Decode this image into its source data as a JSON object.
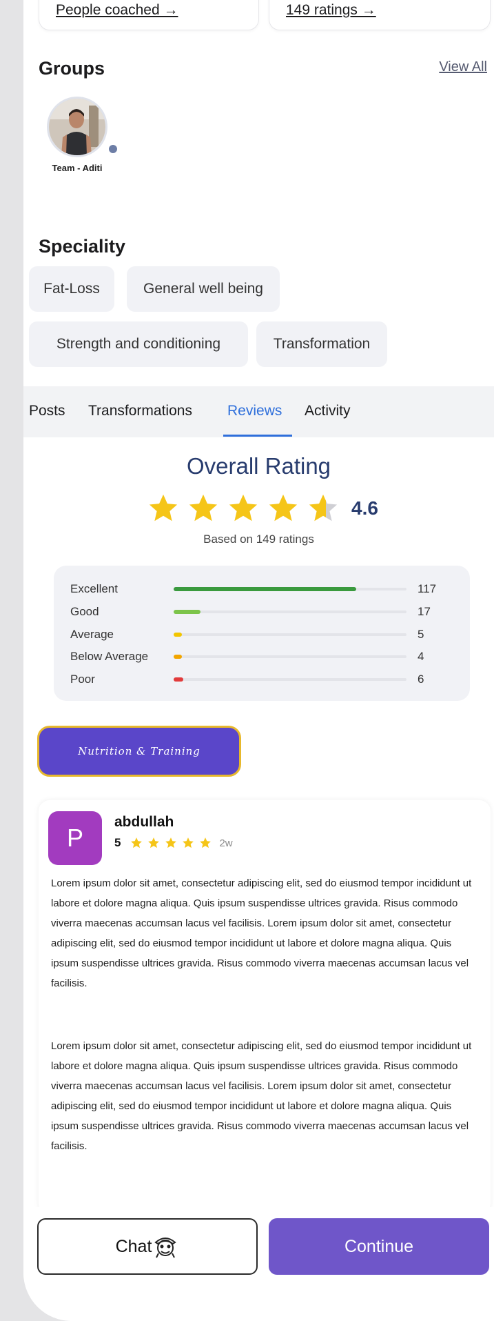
{
  "stats": {
    "people_coached_link": "People coached →",
    "ratings_link": "149 ratings →"
  },
  "groups": {
    "title": "Groups",
    "view_all": "View All",
    "items": [
      {
        "label": "Team - Aditi"
      }
    ]
  },
  "speciality": {
    "title": "Speciality",
    "chips": [
      "Fat-Loss",
      "General well being",
      "Strength and conditioning",
      "Transformation"
    ]
  },
  "tabs": {
    "items": [
      "Posts",
      "Transformations",
      "Reviews",
      "Activity"
    ],
    "active": "Reviews"
  },
  "rating": {
    "title": "Overall Rating",
    "value": "4.6",
    "stars_filled": 4.6,
    "based_on": "Based on 149 ratings",
    "breakdown": [
      {
        "label": "Excellent",
        "count": "117",
        "fraction": 0.785,
        "color": "#3a9a3e"
      },
      {
        "label": "Good",
        "count": "17",
        "fraction": 0.114,
        "color": "#7cc44a"
      },
      {
        "label": "Average",
        "count": "5",
        "fraction": 0.034,
        "color": "#f2c500"
      },
      {
        "label": "Below Average",
        "count": "4",
        "fraction": 0.027,
        "color": "#f2a500"
      },
      {
        "label": "Poor",
        "count": "6",
        "fraction": 0.04,
        "color": "#e23b3b"
      }
    ]
  },
  "nutrition_button": "Nutrition & Training",
  "review": {
    "avatar_letter": "P",
    "avatar_color": "#a23bbf",
    "name": "abdullah",
    "score": "5",
    "stars": 5,
    "time": "2w",
    "paragraph1": "Lorem ipsum dolor sit amet, consectetur adipiscing elit, sed do eiusmod tempor incididunt ut labore et dolore magna aliqua. Quis ipsum suspendisse ultrices gravida. Risus commodo viverra maecenas accumsan lacus vel facilisis. Lorem ipsum dolor sit amet, consectetur adipiscing elit, sed do eiusmod tempor incididunt ut labore et dolore magna aliqua. Quis ipsum suspendisse ultrices gravida. Risus commodo viverra maecenas accumsan lacus vel facilisis.",
    "paragraph2": "Lorem ipsum dolor sit amet, consectetur adipiscing elit, sed do eiusmod tempor incididunt ut labore et dolore magna aliqua. Quis ipsum suspendisse ultrices gravida. Risus commodo viverra maecenas accumsan lacus vel facilisis. Lorem ipsum dolor sit amet, consectetur adipiscing elit, sed do eiusmod tempor incididunt ut labore et dolore magna aliqua. Quis ipsum suspendisse ultrices gravida. Risus commodo viverra maecenas accumsan lacus vel facilisis."
  },
  "bottom": {
    "chat_label": "Chat",
    "continue_label": "Continue"
  },
  "colors": {
    "accent_blue": "#2f6fdb",
    "rating_navy": "#283c6e",
    "star_gold": "#f5c518",
    "primary_purple": "#6f56c9"
  }
}
